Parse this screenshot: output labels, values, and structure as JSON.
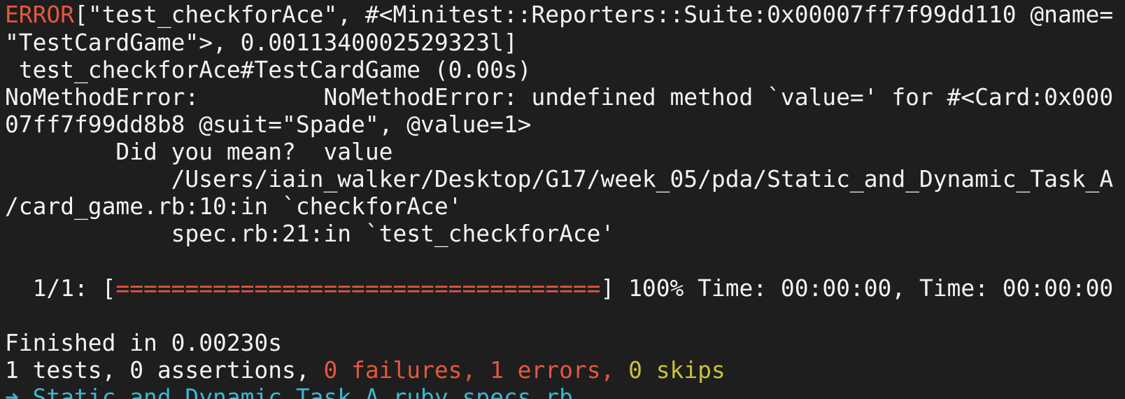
{
  "terminal": {
    "error_header": {
      "tag": "ERROR",
      "rest": "[\"test_checkforAce\", #<Minitest::Reporters::Suite:0x00007ff7f99dd110 @name=",
      "cont": "\"TestCardGame\">, 0.0011340002529323l]"
    },
    "test_line": " test_checkforAce#TestCardGame (0.00s)",
    "nomethod_line": "NoMethodError:         NoMethodError: undefined method `value=' for #<Card:0x000",
    "card_line": "07ff7f99dd8b8 @suit=\"Spade\", @value=1>",
    "didyoumean_line": "        Did you mean?  value",
    "path_line": "            /Users/iain_walker/Desktop/G17/week_05/pda/Static_and_Dynamic_Task_A",
    "cardgame_line": "/card_game.rb:10:in `checkforAce'",
    "spec_line": "            spec.rb:21:in `test_checkforAce'",
    "progress": {
      "prefix": "  1/1: [",
      "bar": "===================================",
      "suffix": "] 100% Time: 00:00:00, Time: 00:00:00",
      "percent": 100
    },
    "finished_line": "Finished in 0.00230s",
    "summary": {
      "tests_assertions": "1 tests, 0 assertions, ",
      "failures": "0 failures, ",
      "errors": "1 errors, ",
      "skips": "0 skips"
    },
    "prompt_partial": "➜ Static_and_Dynamic_Task_A ruby specs.rb"
  },
  "colors": {
    "background": "#1e1e1e",
    "text": "#f2f2f2",
    "error": "#e5573f",
    "skips": "#c9c13a",
    "prompt": "#38b8d0"
  }
}
